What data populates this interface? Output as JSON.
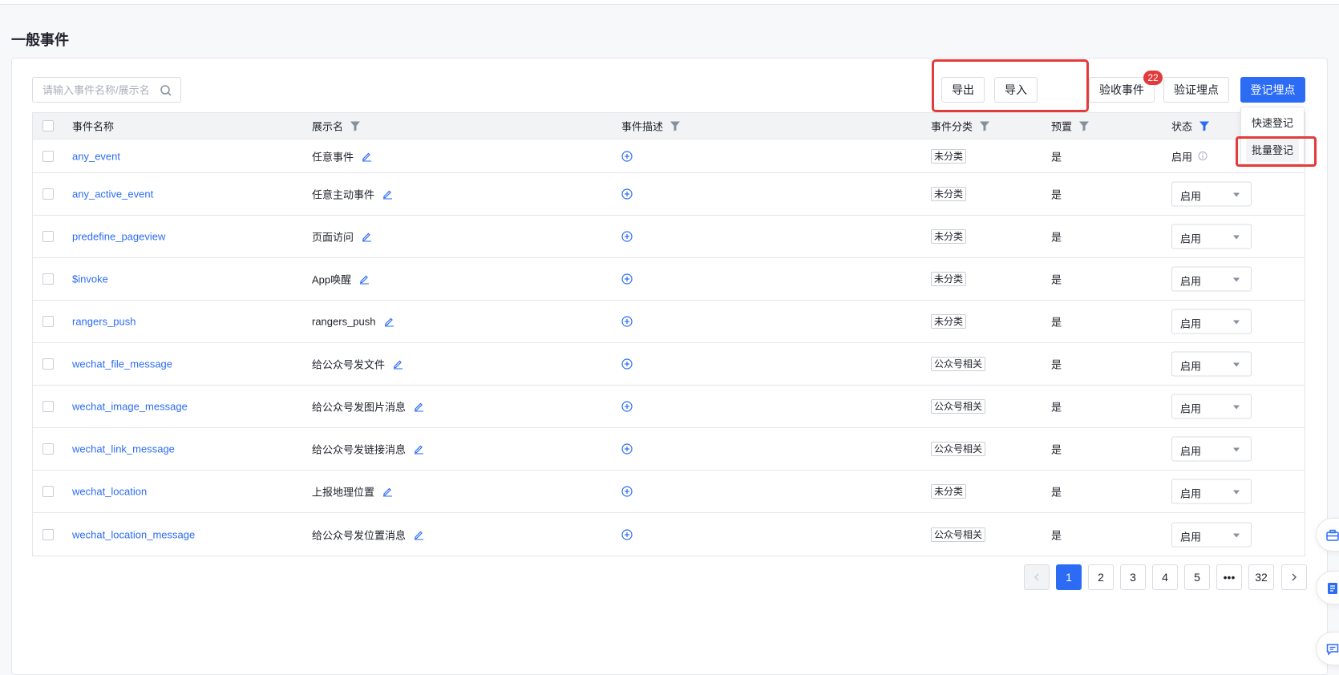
{
  "page": {
    "title": "一般事件"
  },
  "search": {
    "placeholder": "请输入事件名称/展示名"
  },
  "toolbar": {
    "export_label": "导出",
    "import_label": "导入",
    "accept_label": "验收事件",
    "accept_badge": "22",
    "verify_label": "验证埋点",
    "register_label": "登记埋点"
  },
  "register_menu": {
    "items": [
      "快速登记",
      "批量登记"
    ]
  },
  "table": {
    "columns": [
      "事件名称",
      "展示名",
      "事件描述",
      "事件分类",
      "预置",
      "状态"
    ],
    "rows": [
      {
        "name": "any_event",
        "display": "任意事件",
        "category": "未分类",
        "preset": "是",
        "status": "启用"
      },
      {
        "name": "any_active_event",
        "display": "任意主动事件",
        "category": "未分类",
        "preset": "是",
        "status": "启用"
      },
      {
        "name": "predefine_pageview",
        "display": "页面访问",
        "category": "未分类",
        "preset": "是",
        "status": "启用"
      },
      {
        "name": "$invoke",
        "display": "App唤醒",
        "category": "未分类",
        "preset": "是",
        "status": "启用"
      },
      {
        "name": "rangers_push",
        "display": "rangers_push",
        "category": "未分类",
        "preset": "是",
        "status": "启用"
      },
      {
        "name": "wechat_file_message",
        "display": "给公众号发文件",
        "category": "公众号相关",
        "preset": "是",
        "status": "启用"
      },
      {
        "name": "wechat_image_message",
        "display": "给公众号发图片消息",
        "category": "公众号相关",
        "preset": "是",
        "status": "启用"
      },
      {
        "name": "wechat_link_message",
        "display": "给公众号发链接消息",
        "category": "公众号相关",
        "preset": "是",
        "status": "启用"
      },
      {
        "name": "wechat_location",
        "display": "上报地理位置",
        "category": "未分类",
        "preset": "是",
        "status": "启用"
      },
      {
        "name": "wechat_location_message",
        "display": "给公众号发位置消息",
        "category": "公众号相关",
        "preset": "是",
        "status": "启用"
      }
    ]
  },
  "pagination": {
    "pages": [
      "1",
      "2",
      "3",
      "4",
      "5",
      "•••",
      "32"
    ],
    "current": "1"
  },
  "colors": {
    "accent": "#2c6cf5",
    "highlight": "#e33b3b"
  }
}
